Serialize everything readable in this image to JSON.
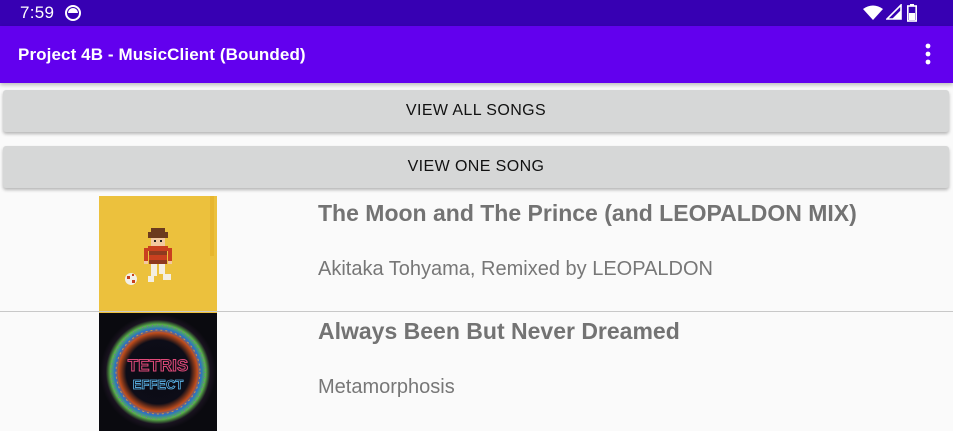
{
  "status_bar": {
    "time": "7:59",
    "icons": [
      "app-notification-icon",
      "wifi-icon",
      "cellular-signal-icon",
      "battery-icon"
    ]
  },
  "app_bar": {
    "title": "Project 4B - MusicClient (Bounded)",
    "menu_icon": "overflow-menu-icon"
  },
  "buttons": {
    "view_all": "VIEW ALL SONGS",
    "view_one": "VIEW ONE SONG"
  },
  "songs": [
    {
      "title": "The Moon and The Prince (and LEOPALDON MIX)",
      "artist": "Akitaka Tohyama, Remixed by LEOPALDON",
      "art_icon": "album-art-pixel-character"
    },
    {
      "title": "Always Been But Never Dreamed",
      "artist": "Metamorphosis",
      "art_icon": "album-art-tetris-effect",
      "art_text_line1": "TETRIS",
      "art_text_line2": "EFFECT"
    }
  ],
  "colors": {
    "status_bar": "#3700b3",
    "app_bar": "#6200ee",
    "button_bg": "#d6d7d7",
    "text_gray": "#737373"
  }
}
